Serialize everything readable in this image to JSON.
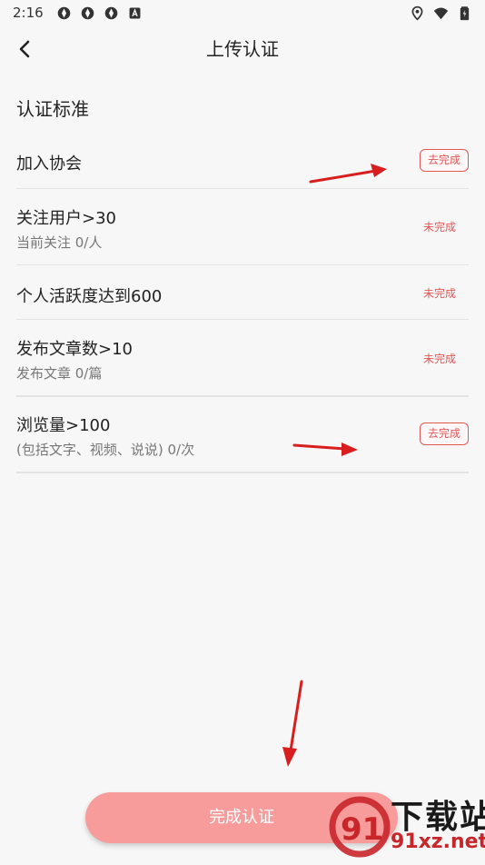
{
  "status_bar": {
    "time": "2:16",
    "left_icons": [
      "app-notification-icon",
      "app-notification-icon",
      "app-notification-icon",
      "text-a-icon"
    ],
    "right_icons": [
      "location-icon",
      "wifi-icon",
      "battery-icon"
    ]
  },
  "app_bar": {
    "back_icon": "chevron-left-icon",
    "title": "上传认证"
  },
  "section": {
    "title": "认证标准"
  },
  "criteria": [
    {
      "title": "加入协会",
      "subtitle": "",
      "status": "去完成",
      "status_type": "button"
    },
    {
      "title": "关注用户>30",
      "subtitle": "当前关注 0/人",
      "status": "未完成",
      "status_type": "text"
    },
    {
      "title": "个人活跃度达到600",
      "subtitle": "",
      "status": "未完成",
      "status_type": "text"
    },
    {
      "title": "发布文章数>10",
      "subtitle": "发布文章 0/篇",
      "status": "未完成",
      "status_type": "text"
    },
    {
      "title": "浏览量>100",
      "subtitle": "(包括文字、视频、说说) 0/次",
      "status": "去完成",
      "status_type": "button"
    }
  ],
  "submit": {
    "label": "完成认证"
  },
  "watermark": {
    "line1": "下载站",
    "line2": "91xz.net"
  },
  "colors": {
    "accent": "#e25757",
    "submit_bg": "#f79b9b",
    "background": "#f7f7f7",
    "annotation_arrow": "#d81e1e"
  }
}
